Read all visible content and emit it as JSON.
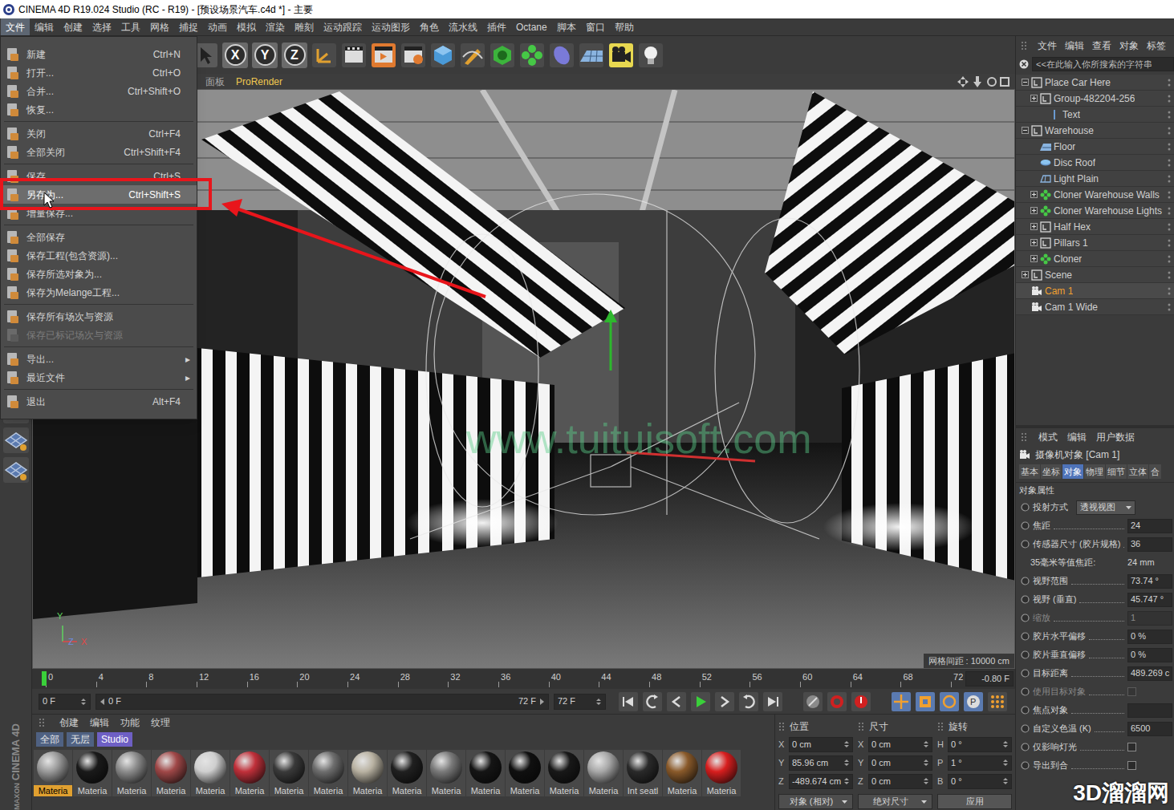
{
  "window": {
    "title": "CINEMA 4D R19.024 Studio (RC - R19) - [预设场景汽车.c4d *] - 主要"
  },
  "menubar": [
    {
      "label": "文件",
      "selected": true
    },
    {
      "label": "编辑",
      "selected": false
    },
    {
      "label": "创建",
      "selected": false
    },
    {
      "label": "选择",
      "selected": false
    },
    {
      "label": "工具",
      "selected": false
    },
    {
      "label": "网格",
      "selected": false
    },
    {
      "label": "捕捉",
      "selected": false
    },
    {
      "label": "动画",
      "selected": false
    },
    {
      "label": "模拟",
      "selected": false
    },
    {
      "label": "渲染",
      "selected": false
    },
    {
      "label": "雕刻",
      "selected": false
    },
    {
      "label": "运动跟踪",
      "selected": false
    },
    {
      "label": "运动图形",
      "selected": false
    },
    {
      "label": "角色",
      "selected": false
    },
    {
      "label": "流水线",
      "selected": false
    },
    {
      "label": "插件",
      "selected": false
    },
    {
      "label": "Octane",
      "selected": false
    },
    {
      "label": "脚本",
      "selected": false
    },
    {
      "label": "窗口",
      "selected": false
    },
    {
      "label": "帮助",
      "selected": false
    }
  ],
  "toolbar": {
    "axis_buttons": [
      "X",
      "Y",
      "Z"
    ]
  },
  "file_menu": {
    "items": [
      {
        "kind": "item",
        "label": "新建",
        "shortcut": "Ctrl+N",
        "highlighted": false,
        "disabled": false
      },
      {
        "kind": "item",
        "label": "打开...",
        "shortcut": "Ctrl+O",
        "highlighted": false,
        "disabled": false
      },
      {
        "kind": "item",
        "label": "合并...",
        "shortcut": "Ctrl+Shift+O",
        "highlighted": false,
        "disabled": false
      },
      {
        "kind": "item",
        "label": "恢复...",
        "highlighted": false,
        "disabled": false
      },
      {
        "kind": "separator"
      },
      {
        "kind": "item",
        "label": "关闭",
        "shortcut": "Ctrl+F4",
        "highlighted": false,
        "disabled": false
      },
      {
        "kind": "item",
        "label": "全部关闭",
        "shortcut": "Ctrl+Shift+F4",
        "highlighted": false,
        "disabled": false
      },
      {
        "kind": "separator"
      },
      {
        "kind": "item",
        "label": "保存",
        "shortcut": "Ctrl+S",
        "highlighted": false,
        "disabled": false
      },
      {
        "kind": "item",
        "label": "另存为...",
        "shortcut": "Ctrl+Shift+S",
        "highlighted": true,
        "disabled": false
      },
      {
        "kind": "item",
        "label": "增量保存...",
        "highlighted": false,
        "disabled": false
      },
      {
        "kind": "separator"
      },
      {
        "kind": "item",
        "label": "全部保存",
        "highlighted": false,
        "disabled": false
      },
      {
        "kind": "item",
        "label": "保存工程(包含资源)...",
        "highlighted": false,
        "disabled": false
      },
      {
        "kind": "item",
        "label": "保存所选对象为...",
        "highlighted": false,
        "disabled": false
      },
      {
        "kind": "item",
        "label": "保存为Melange工程...",
        "highlighted": false,
        "disabled": false
      },
      {
        "kind": "separator"
      },
      {
        "kind": "item",
        "label": "保存所有场次与资源",
        "highlighted": false,
        "disabled": false
      },
      {
        "kind": "item",
        "label": "保存已标记场次与资源",
        "highlighted": false,
        "disabled": true
      },
      {
        "kind": "separator"
      },
      {
        "kind": "submenu",
        "label": "导出...",
        "arrow": "▸",
        "highlighted": false,
        "disabled": false
      },
      {
        "kind": "submenu",
        "label": "最近文件",
        "arrow": "▸",
        "highlighted": false,
        "disabled": false
      },
      {
        "kind": "separator"
      },
      {
        "kind": "item",
        "label": "退出",
        "shortcut": "Alt+F4",
        "highlighted": false,
        "disabled": false
      }
    ]
  },
  "viewport": {
    "menu": [
      {
        "label": "面板",
        "selected": false
      },
      {
        "label": "ProRender",
        "selected": true
      }
    ],
    "grid_spacing": "网格间距 : 10000 cm",
    "axes": [
      {
        "label": "Y",
        "color": "#5fd35f"
      },
      {
        "label": "Z",
        "color": "#6f8be0"
      },
      {
        "label": "X",
        "color": "#e04848"
      }
    ],
    "watermark": "www.tuituisoft.com"
  },
  "object_manager": {
    "menu": [
      "文件",
      "编辑",
      "查看",
      "对象",
      "标签"
    ],
    "search": {
      "placeholder": "<<在此输入你所搜索的字符串"
    },
    "items": [
      {
        "label": "Place Car Here",
        "depth": 0,
        "kind": "null",
        "has_children": true,
        "expanded": true,
        "selected": false
      },
      {
        "label": "Group-482204-256",
        "depth": 1,
        "kind": "null",
        "has_children": true,
        "expanded": false,
        "selected": false
      },
      {
        "label": "Text",
        "depth": 2,
        "kind": "text",
        "has_children": false,
        "expanded": false,
        "selected": false
      },
      {
        "label": "Warehouse",
        "depth": 0,
        "kind": "null",
        "has_children": true,
        "expanded": true,
        "selected": false
      },
      {
        "label": "Floor",
        "depth": 1,
        "kind": "floor",
        "has_children": false,
        "expanded": false,
        "selected": false
      },
      {
        "label": "Disc Roof",
        "depth": 1,
        "kind": "disc",
        "has_children": false,
        "expanded": false,
        "selected": false
      },
      {
        "label": "Light Plain",
        "depth": 1,
        "kind": "plane",
        "has_children": false,
        "expanded": false,
        "selected": false
      },
      {
        "label": "Cloner Warehouse Walls",
        "depth": 1,
        "kind": "cloner",
        "has_children": true,
        "expanded": false,
        "selected": false
      },
      {
        "label": "Cloner Warehouse Lights",
        "depth": 1,
        "kind": "cloner",
        "has_children": true,
        "expanded": false,
        "selected": false
      },
      {
        "label": "Half Hex",
        "depth": 1,
        "kind": "null",
        "has_children": true,
        "expanded": false,
        "selected": false
      },
      {
        "label": "Pillars 1",
        "depth": 1,
        "kind": "null",
        "has_children": true,
        "expanded": false,
        "selected": false
      },
      {
        "label": "Cloner",
        "depth": 1,
        "kind": "cloner",
        "has_children": true,
        "expanded": false,
        "selected": false
      },
      {
        "label": "Scene",
        "depth": 0,
        "kind": "null",
        "has_children": true,
        "expanded": false,
        "selected": false
      },
      {
        "label": "Cam 1",
        "depth": 0,
        "kind": "camera",
        "has_children": false,
        "expanded": false,
        "selected": true
      },
      {
        "label": "Cam 1 Wide",
        "depth": 0,
        "kind": "camera",
        "has_children": false,
        "expanded": false,
        "selected": false
      }
    ]
  },
  "attributes": {
    "menu": [
      "模式",
      "编辑",
      "用户数据"
    ],
    "title": "摄像机对象 [Cam 1]",
    "tabs": [
      {
        "label": "基本",
        "selected": false
      },
      {
        "label": "坐标",
        "selected": false
      },
      {
        "label": "对象",
        "selected": true
      },
      {
        "label": "物理",
        "selected": false
      },
      {
        "label": "细节",
        "selected": false
      },
      {
        "label": "立体",
        "selected": false
      },
      {
        "label": "合",
        "selected": false
      }
    ],
    "section": "对象属性",
    "properties": [
      {
        "kind": "dropdown",
        "label": "投射方式",
        "value": "透视视图",
        "disabled": false
      },
      {
        "kind": "number",
        "label": "焦距",
        "value": "24",
        "disabled": false
      },
      {
        "kind": "number",
        "label": "传感器尺寸 (胶片规格)",
        "value": "36",
        "disabled": false
      },
      {
        "kind": "readonly",
        "label": "35毫米等值焦距:",
        "value": "24 mm",
        "disabled": false
      },
      {
        "kind": "number",
        "label": "视野范围",
        "value": "73.74 °",
        "disabled": false
      },
      {
        "kind": "number",
        "label": "视野 (垂直)",
        "value": "45.747 °",
        "disabled": false
      },
      {
        "kind": "number",
        "label": "缩放",
        "value": "1",
        "disabled": true
      },
      {
        "kind": "number",
        "label": "胶片水平偏移",
        "value": "0 %",
        "disabled": false
      },
      {
        "kind": "number",
        "label": "胶片垂直偏移",
        "value": "0 %",
        "disabled": false
      },
      {
        "kind": "number",
        "label": "目标距离",
        "value": "489.269 c",
        "disabled": false
      },
      {
        "kind": "checkbox",
        "label": "使用目标对象",
        "checked": false,
        "disabled": true
      },
      {
        "kind": "link",
        "label": "焦点对象",
        "disabled": false
      },
      {
        "kind": "number",
        "label": "自定义色温 (K)",
        "value": "6500",
        "disabled": false
      },
      {
        "kind": "checkbox",
        "label": "仅影响灯光",
        "checked": false,
        "disabled": false
      },
      {
        "kind": "checkbox",
        "label": "导出到合",
        "checked": false,
        "disabled": false
      }
    ]
  },
  "timeline": {
    "ticks": [
      "0",
      "4",
      "8",
      "12",
      "16",
      "20",
      "24",
      "28",
      "32",
      "36",
      "40",
      "44",
      "48",
      "52",
      "56",
      "60",
      "64",
      "68",
      "72"
    ],
    "playhead_level": 0,
    "readout": "-0.80 F",
    "start_field": "0 F",
    "range_start": "0 F",
    "range_end": "72 F",
    "end_field": "72 F"
  },
  "materials": {
    "menu": [
      "创建",
      "编辑",
      "功能",
      "纹理"
    ],
    "filters": [
      {
        "label": "全部",
        "selected": false
      },
      {
        "label": "无层",
        "selected": false
      },
      {
        "label": "Studio",
        "selected": true
      }
    ],
    "items": [
      {
        "name": "Materia",
        "selected": true,
        "color": "#9a9a9a"
      },
      {
        "name": "Materia",
        "selected": false,
        "color": "#1a1a1a"
      },
      {
        "name": "Materia",
        "selected": false,
        "color": "#8c8c8c"
      },
      {
        "name": "Materia",
        "selected": false,
        "color": "#a04848"
      },
      {
        "name": "Materia",
        "selected": false,
        "color": "#cfcfcf"
      },
      {
        "name": "Materia",
        "selected": false,
        "color": "#c0303a"
      },
      {
        "name": "Materia",
        "selected": false,
        "color": "#3a3a3a"
      },
      {
        "name": "Materia",
        "selected": false,
        "color": "#6e6e6e"
      },
      {
        "name": "Materia",
        "selected": false,
        "color": "#b9b2a2"
      },
      {
        "name": "Materia",
        "selected": false,
        "color": "#202020"
      },
      {
        "name": "Materia",
        "selected": false,
        "color": "#7a7a7a"
      },
      {
        "name": "Materia",
        "selected": false,
        "color": "#151515"
      },
      {
        "name": "Materia",
        "selected": false,
        "color": "#101010"
      },
      {
        "name": "Materia",
        "selected": false,
        "color": "#181818"
      },
      {
        "name": "Materia",
        "selected": false,
        "color": "#a8a8a8"
      },
      {
        "name": "Int seatl",
        "selected": false,
        "color": "#2a2a2a"
      },
      {
        "name": "Materia",
        "selected": false,
        "color": "#8a5a2a"
      },
      {
        "name": "Materia",
        "selected": false,
        "color": "#d81e1e"
      }
    ]
  },
  "coordinates": {
    "headers": [
      "位置",
      "尺寸",
      "旋转"
    ],
    "rows": [
      [
        {
          "axis": "X",
          "value": "0 cm"
        },
        {
          "axis": "X",
          "value": "0 cm"
        },
        {
          "axis": "H",
          "value": "0 °"
        }
      ],
      [
        {
          "axis": "Y",
          "value": "85.96 cm"
        },
        {
          "axis": "Y",
          "value": "0 cm"
        },
        {
          "axis": "P",
          "value": "1 °"
        }
      ],
      [
        {
          "axis": "Z",
          "value": "-489.674 cm"
        },
        {
          "axis": "Z",
          "value": "0 cm"
        },
        {
          "axis": "B",
          "value": "0 °"
        }
      ]
    ],
    "mode": "对象 (相对)",
    "size_mode": "绝对尺寸",
    "apply": "应用"
  },
  "logo": {
    "brand": "MAXON",
    "product": "CINEMA 4D"
  },
  "watermark": "3D溜溜网"
}
